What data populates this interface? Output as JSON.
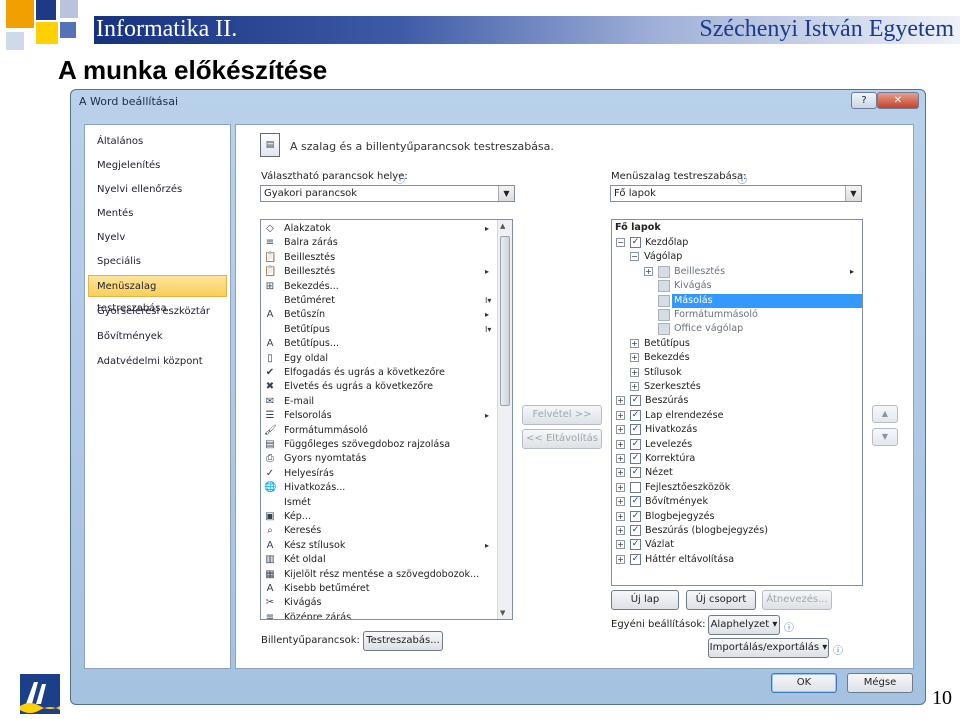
{
  "slide": {
    "header_left": "Informatika II.",
    "header_right": "Széchenyi István Egyetem",
    "title": "A munka előkészítése",
    "page_number": "10"
  },
  "window": {
    "title": "A Word beállításai",
    "help_label": "?",
    "close_label": "✕"
  },
  "nav": [
    {
      "label": "Általános"
    },
    {
      "label": "Megjelenítés"
    },
    {
      "label": "Nyelvi ellenőrzés"
    },
    {
      "label": "Mentés"
    },
    {
      "label": "Nyelv"
    },
    {
      "label": "Speciális"
    },
    {
      "label": "Menüszalag testreszabása",
      "selected": true
    },
    {
      "label": "Gyorselérési eszköztár"
    },
    {
      "label": "Bővítmények"
    },
    {
      "label": "Adatvédelmi központ"
    }
  ],
  "main": {
    "heading": "A szalag és a billentyűparancsok testreszabása.",
    "left_label": "Választható parancsok helye:",
    "left_combo": "Gyakori parancsok",
    "right_label": "Menüszalag testreszabása:",
    "right_combo": "Fő lapok",
    "add_button": "Felvétel >>",
    "remove_button": "<< Eltávolítás",
    "commands": [
      {
        "icon": "shapes-icon",
        "glyph": "◇",
        "label": "Alakzatok",
        "sub": "▸"
      },
      {
        "icon": "align-left-icon",
        "glyph": "≡",
        "label": "Balra zárás",
        "sub": ""
      },
      {
        "icon": "paste-icon",
        "glyph": "📋",
        "label": "Beillesztés",
        "sub": ""
      },
      {
        "icon": "paste-icon",
        "glyph": "📋",
        "label": "Beillesztés",
        "sub": "▸"
      },
      {
        "icon": "insert-icon",
        "glyph": "⊞",
        "label": "Bekezdés...",
        "sub": ""
      },
      {
        "icon": "font-size-icon",
        "glyph": "",
        "label": "Betűméret",
        "sub": "I▾"
      },
      {
        "icon": "font-color-icon",
        "glyph": "A",
        "label": "Betűszín",
        "sub": "▸"
      },
      {
        "icon": "font-icon",
        "glyph": "",
        "label": "Betűtípus",
        "sub": "I▾"
      },
      {
        "icon": "font-dialog-icon",
        "glyph": "A",
        "label": "Betűtípus...",
        "sub": ""
      },
      {
        "icon": "page-icon",
        "glyph": "▯",
        "label": "Egy oldal",
        "sub": ""
      },
      {
        "icon": "accept-icon",
        "glyph": "✔",
        "label": "Elfogadás és ugrás a következőre",
        "sub": ""
      },
      {
        "icon": "reject-icon",
        "glyph": "✖",
        "label": "Elvetés és ugrás a következőre",
        "sub": ""
      },
      {
        "icon": "email-icon",
        "glyph": "✉",
        "label": "E-mail",
        "sub": ""
      },
      {
        "icon": "bullets-icon",
        "glyph": "☰",
        "label": "Felsorolás",
        "sub": "▸"
      },
      {
        "icon": "format-painter-icon",
        "glyph": "🖌",
        "label": "Formátummásoló",
        "sub": ""
      },
      {
        "icon": "textbox-icon",
        "glyph": "▤",
        "label": "Függőleges szövegdoboz rajzolása",
        "sub": ""
      },
      {
        "icon": "print-icon",
        "glyph": "⎙",
        "label": "Gyors nyomtatás",
        "sub": ""
      },
      {
        "icon": "spelling-icon",
        "glyph": "✓",
        "label": "Helyesírás",
        "sub": ""
      },
      {
        "icon": "hyperlink-icon",
        "glyph": "🌐",
        "label": "Hivatkozás...",
        "sub": ""
      },
      {
        "icon": "blank-icon",
        "glyph": "",
        "label": "Ismét",
        "sub": ""
      },
      {
        "icon": "picture-icon",
        "glyph": "▣",
        "label": "Kép...",
        "sub": ""
      },
      {
        "icon": "find-icon",
        "glyph": "⌕",
        "label": "Keresés",
        "sub": ""
      },
      {
        "icon": "styles-icon",
        "glyph": "A",
        "label": "Kész stílusok",
        "sub": "▸"
      },
      {
        "icon": "two-page-icon",
        "glyph": "▥",
        "label": "Két oldal",
        "sub": ""
      },
      {
        "icon": "save-selection-icon",
        "glyph": "▦",
        "label": "Kijelölt rész mentése a szövegdobozok...",
        "sub": ""
      },
      {
        "icon": "shrink-font-icon",
        "glyph": "A",
        "label": "Kisebb betűméret",
        "sub": ""
      },
      {
        "icon": "cut-icon",
        "glyph": "✂",
        "label": "Kivágás",
        "sub": ""
      },
      {
        "icon": "center-icon",
        "glyph": "≡",
        "label": "Középre zárás",
        "sub": ""
      }
    ],
    "tree_header": "Fő lapok",
    "tree": [
      {
        "level": 0,
        "exp": "⊟",
        "check": true,
        "label": "Kezdőlap"
      },
      {
        "level": 1,
        "exp": "⊟",
        "check": null,
        "label": "Vágólap"
      },
      {
        "level": 2,
        "exp": "⊞",
        "check": null,
        "label": "Beillesztés",
        "icon": "paste-icon",
        "sub": "▸",
        "grey": true
      },
      {
        "level": 2,
        "exp": "",
        "check": null,
        "label": "Kivágás",
        "icon": "cut-icon",
        "grey": true
      },
      {
        "level": 2,
        "exp": "",
        "check": null,
        "label": "Másolás",
        "icon": "copy-icon",
        "grey": true,
        "selected": true
      },
      {
        "level": 2,
        "exp": "",
        "check": null,
        "label": "Formátummásoló",
        "icon": "format-painter-icon",
        "grey": true
      },
      {
        "level": 2,
        "exp": "",
        "check": null,
        "label": "Office vágólap",
        "icon": "blank-icon",
        "grey": true
      },
      {
        "level": 1,
        "exp": "⊞",
        "check": null,
        "label": "Betűtípus"
      },
      {
        "level": 1,
        "exp": "⊞",
        "check": null,
        "label": "Bekezdés"
      },
      {
        "level": 1,
        "exp": "⊞",
        "check": null,
        "label": "Stílusok"
      },
      {
        "level": 1,
        "exp": "⊞",
        "check": null,
        "label": "Szerkesztés"
      },
      {
        "level": 0,
        "exp": "⊞",
        "check": true,
        "label": "Beszúrás"
      },
      {
        "level": 0,
        "exp": "⊞",
        "check": true,
        "label": "Lap elrendezése"
      },
      {
        "level": 0,
        "exp": "⊞",
        "check": true,
        "label": "Hivatkozás"
      },
      {
        "level": 0,
        "exp": "⊞",
        "check": true,
        "label": "Levelezés"
      },
      {
        "level": 0,
        "exp": "⊞",
        "check": true,
        "label": "Korrektúra"
      },
      {
        "level": 0,
        "exp": "⊞",
        "check": true,
        "label": "Nézet"
      },
      {
        "level": 0,
        "exp": "⊞",
        "check": false,
        "label": "Fejlesztőeszközök"
      },
      {
        "level": 0,
        "exp": "⊞",
        "check": true,
        "label": "Bővítmények"
      },
      {
        "level": 0,
        "exp": "⊞",
        "check": true,
        "label": "Blogbejegyzés"
      },
      {
        "level": 0,
        "exp": "⊞",
        "check": true,
        "label": "Beszúrás (blogbejegyzés)"
      },
      {
        "level": 0,
        "exp": "⊞",
        "check": true,
        "label": "Vázlat"
      },
      {
        "level": 0,
        "exp": "⊞",
        "check": true,
        "label": "Háttér eltávolítása"
      }
    ],
    "new_tab_button": "Új lap",
    "new_group_button": "Új csoport",
    "rename_button": "Átnevezés...",
    "custom_label": "Egyéni beállítások:",
    "reset_button": "Alaphelyzet ▾",
    "import_export_button": "Importálás/exportálás ▾",
    "shortcuts_label": "Billentyűparancsok:",
    "customize_button": "Testreszabás..."
  },
  "footer": {
    "ok_button": "OK",
    "cancel_button": "Mégse"
  },
  "colors": {
    "header_blue": "#16327f",
    "selection_blue": "#3399ff",
    "nav_selected": "#fbcf57"
  }
}
